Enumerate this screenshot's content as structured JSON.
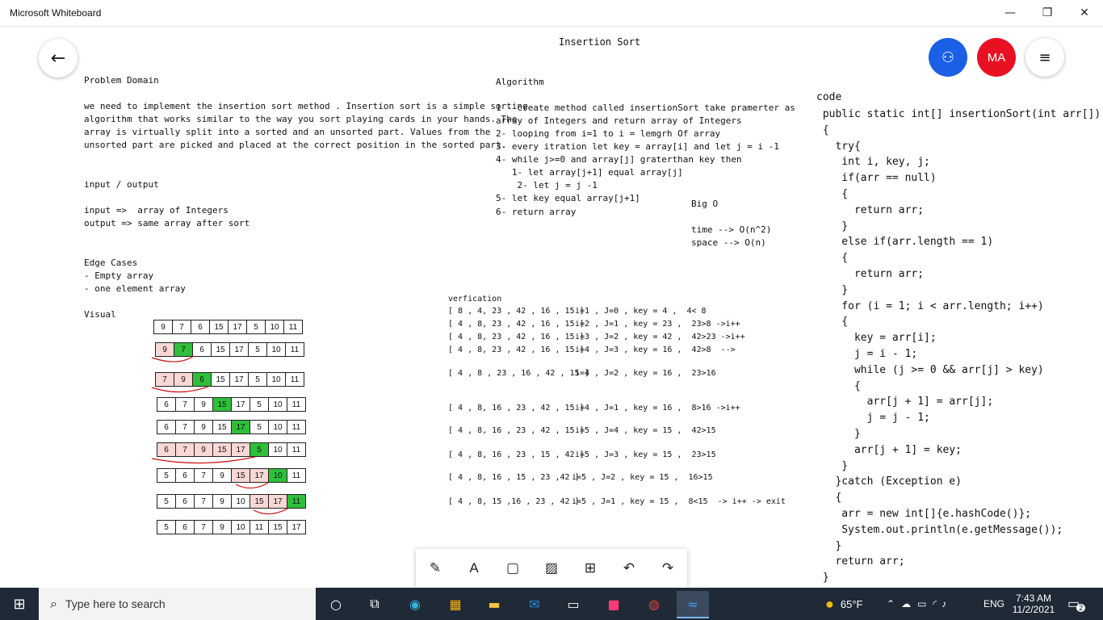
{
  "window": {
    "title": "Microsoft Whiteboard",
    "minimize": "—",
    "restore": "❐",
    "close": "✕"
  },
  "board": {
    "title": "Insertion Sort",
    "problem_domain": {
      "heading": "Problem Domain",
      "lines": [
        "we need to implement the insertion sort method . Insertion sort is a simple sorting",
        "algorithm that works similar to the way you sort playing cards in your hands. The",
        "array is virtually split into a sorted and an unsorted part. Values from the",
        "unsorted part are picked and placed at the correct position in the sorted part."
      ]
    },
    "io": {
      "heading": "input / output",
      "input": "input =>  array of Integers",
      "output": "output => same array after sort"
    },
    "edge": {
      "heading": "Edge Cases",
      "items": [
        "- Empty array",
        "- one element array"
      ]
    },
    "visual": {
      "heading": "Visual",
      "rows": [
        {
          "values": [
            "9",
            "7",
            "6",
            "15",
            "17",
            "5",
            "10",
            "11"
          ],
          "pink": [],
          "green": []
        },
        {
          "values": [
            "9",
            "7",
            "6",
            "15",
            "17",
            "5",
            "10",
            "11"
          ],
          "pink": [
            0
          ],
          "green": [
            1
          ]
        },
        {
          "values": [
            "7",
            "9",
            "6",
            "15",
            "17",
            "5",
            "10",
            "11"
          ],
          "pink": [
            0,
            1
          ],
          "green": [
            2
          ]
        },
        {
          "values": [
            "6",
            "7",
            "9",
            "15",
            "17",
            "5",
            "10",
            "11"
          ],
          "pink": [],
          "green": [
            3
          ]
        },
        {
          "values": [
            "6",
            "7",
            "9",
            "15",
            "17",
            "5",
            "10",
            "11"
          ],
          "pink": [],
          "green": [
            4
          ]
        },
        {
          "values": [
            "6",
            "7",
            "9",
            "15",
            "17",
            "5",
            "10",
            "11"
          ],
          "pink": [
            0,
            1,
            2,
            3,
            4
          ],
          "green": [
            5
          ]
        },
        {
          "values": [
            "5",
            "6",
            "7",
            "9",
            "15",
            "17",
            "10",
            "11"
          ],
          "pink": [
            4,
            5
          ],
          "green": [
            6
          ]
        },
        {
          "values": [
            "5",
            "6",
            "7",
            "9",
            "10",
            "15",
            "17",
            "11"
          ],
          "pink": [
            5,
            6
          ],
          "green": [
            7
          ]
        },
        {
          "values": [
            "5",
            "6",
            "7",
            "9",
            "10",
            "11",
            "15",
            "17"
          ],
          "pink": [],
          "green": []
        }
      ]
    },
    "algorithm": {
      "heading": "Algorithm",
      "lines": [
        "1 - create method called insertionSort take pramerter as",
        "array of Integers and return array of Integers",
        "2- looping from i=1 to i = lemgrh Of array",
        "3- every itration let key = array[i] and let j = i -1",
        "4- while j>=0 and array[j] graterthan key then",
        "   1- let array[j+1] equal array[j]",
        "    2- let j = j -1",
        "5- let key equal array[j+1]",
        "6- return array"
      ]
    },
    "bigo": {
      "heading": "Big O",
      "time": "time --> O(n^2)",
      "space": "space --> O(n)"
    },
    "verification": {
      "heading": "verfication",
      "rows": [
        {
          "arr": "[ 8 , 4, 23 , 42 , 16 , 15 ]",
          "note": "i=1 , J=0 , key = 4 ,  4< 8"
        },
        {
          "arr": "[ 4 , 8, 23 , 42 , 16 , 15 ]",
          "note": "i=2 , J=1 , key = 23 ,  23>8 ->i++"
        },
        {
          "arr": "[ 4 , 8, 23 , 42 , 16 , 15 ]",
          "note": "i=3 , J=2 , key = 42 ,  42>23 ->i++"
        },
        {
          "arr": "[ 4 , 8, 23 , 42 , 16 , 15 ]",
          "note": "i=4 , J=3 , key = 16 ,  42>8  -->"
        },
        {
          "arr": "[ 4 , 8 , 23 , 16 , 42 , 15 ]",
          "note": "i=4 , J=2 , key = 16 ,  23>16"
        },
        {
          "arr": "[ 4 , 8, 16 , 23 , 42 , 15 ]",
          "note": "i=4 , J=1 , key = 16 ,  8>16 ->i++"
        },
        {
          "arr": "[ 4 , 8, 16 , 23 , 42 , 15 ]",
          "note": "i=5 , J=4 , key = 15 ,  42>15"
        },
        {
          "arr": "[ 4 , 8, 16 , 23 , 15 , 42 ]",
          "note": "i=5 , J=3 , key = 15 ,  23>15"
        },
        {
          "arr": "[ 4 , 8, 16 , 15 , 23 ,42 ]",
          "note": "i=5 , J=2 , key = 15 ,  16>15"
        },
        {
          "arr": "[ 4 , 8, 15 ,16 , 23 , 42 ]",
          "note": "i=5 , J=1 , key = 15 ,  8<15  -> i++ -> exit"
        }
      ]
    },
    "code": {
      "heading": "code",
      "lines": [
        " public static int[] insertionSort(int arr[])",
        " {",
        "   try{",
        "    int i, key, j;",
        "    if(arr == null)",
        "    {",
        "      return arr;",
        "    }",
        "    else if(arr.length == 1)",
        "    {",
        "      return arr;",
        "    }",
        "    for (i = 1; i < arr.length; i++)",
        "    {",
        "      key = arr[i];",
        "      j = i - 1;",
        "      while (j >= 0 && arr[j] > key)",
        "      {",
        "        arr[j + 1] = arr[j];",
        "        j = j - 1;",
        "      }",
        "      arr[j + 1] = key;",
        "    }",
        "   }catch (Exception e)",
        "   {",
        "    arr = new int[]{e.hashCode()};",
        "    System.out.println(e.getMessage());",
        "   }",
        "   return arr;",
        " }"
      ]
    }
  },
  "user": {
    "initials": "MA"
  },
  "taskbar": {
    "search_placeholder": "Type here to search",
    "weather": "65°F",
    "lang": "ENG",
    "time": "7:43 AM",
    "date": "11/2/2021",
    "notifications": "2"
  },
  "colors": {
    "pink": "#f8d7d5",
    "green": "#2fbf3a",
    "share": "#1a5fe6",
    "avatar": "#e81123",
    "arrow": "#cc1111"
  }
}
